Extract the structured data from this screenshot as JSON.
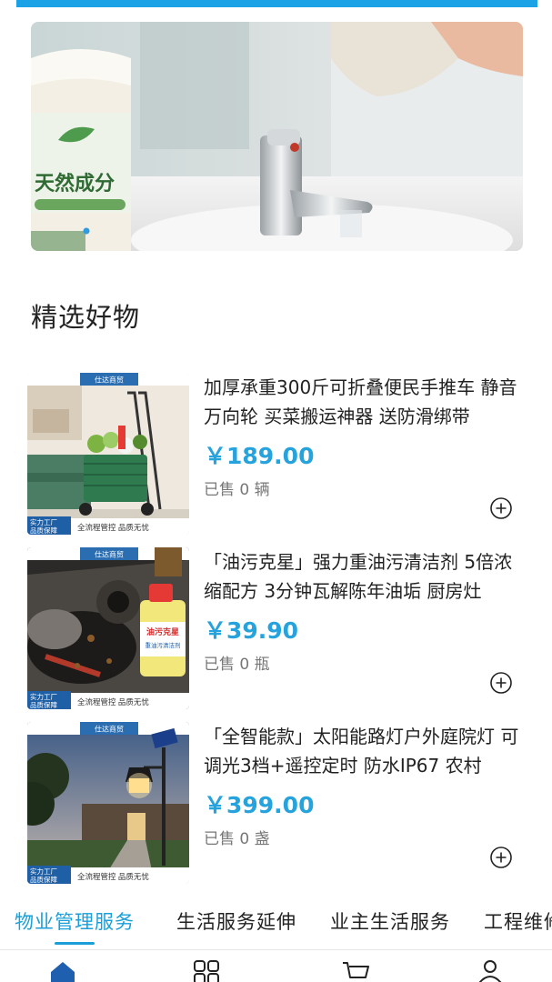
{
  "colors": {
    "accent": "#1aa1e6",
    "price": "#26a3dd",
    "text": "#222222",
    "muted": "#777777"
  },
  "banner": {
    "product_text": "天然成分",
    "active_dot": 0
  },
  "section": {
    "title": "精选好物"
  },
  "badges": {
    "brand": "仕达商贸",
    "factory_line1": "实力工厂",
    "factory_line2": "品质保障",
    "quality": "全流程管控  品质无忧"
  },
  "products": [
    {
      "title": "加厚承重300斤可折叠便民手推车 静音万向轮 买菜搬运神器 送防滑绑带",
      "price": "￥189.00",
      "sold": "已售 0 辆",
      "icon": "plus-circle-icon"
    },
    {
      "title": "「油污克星」强力重油污清洁剂 5倍浓缩配方 3分钟瓦解陈年油垢 厨房灶",
      "price": "￥39.90",
      "sold": "已售 0 瓶",
      "icon": "plus-circle-icon",
      "bottle_text_1": "油污克星",
      "bottle_text_2": "重油污清洁剂"
    },
    {
      "title": "「全智能款」太阳能路灯户外庭院灯 可调光3档+遥控定时 防水IP67 农村",
      "price": "￥399.00",
      "sold": "已售 0 盏",
      "icon": "plus-circle-icon"
    }
  ],
  "tabs": [
    {
      "label": "物业管理服务",
      "active": true
    },
    {
      "label": "生活服务延伸",
      "active": false
    },
    {
      "label": "业主生活服务",
      "active": false
    },
    {
      "label": "工程维修",
      "active": false
    }
  ],
  "bottom_nav": [
    {
      "icon": "home-icon",
      "active": true
    },
    {
      "icon": "grid-icon",
      "active": false
    },
    {
      "icon": "cart-icon",
      "active": false
    },
    {
      "icon": "user-icon",
      "active": false
    }
  ]
}
